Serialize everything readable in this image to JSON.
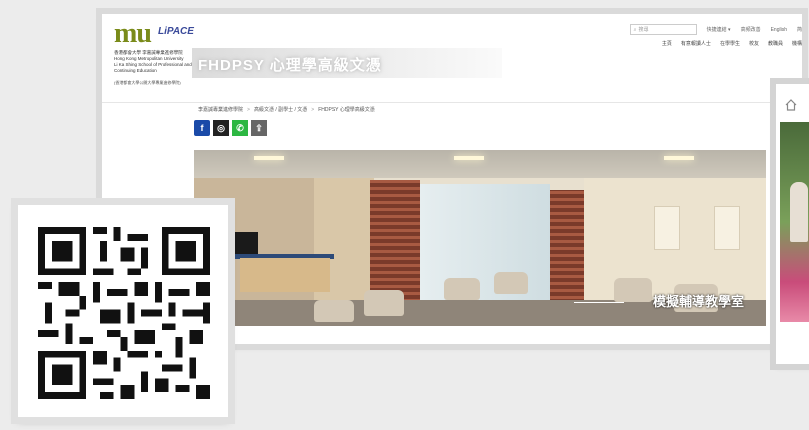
{
  "logo": {
    "mark": "mu",
    "brand": "LiPACE",
    "lines": [
      "香港都會大學 李嘉誠專業進修學院",
      "Hong Kong Metropolitan University",
      "Li Ka Shing School of Professional and",
      "Continuing Education"
    ],
    "slogan": "(香港都會大學公開大學專業進修學院)"
  },
  "banner_title": "FHDPSY 心理學高級文憑",
  "topbar": {
    "search_placeholder": "搜尋",
    "quick_links": "快捷連結",
    "sep": "▾",
    "lang_1": "高頻改善",
    "lang_2": "English",
    "lang_3": "简"
  },
  "nav": [
    "主頁",
    "有意報讀人士",
    "在學學生",
    "校友",
    "教職員",
    "機構"
  ],
  "breadcrumb": [
    "李嘉誠專業進修學院",
    "高級文憑 / 副學士 / 文憑",
    "FHDPSY 心理學高級文憑"
  ],
  "breadcrumb_sep": ">",
  "social": {
    "facebook": "f",
    "instagram": "◎",
    "whatsapp": "✆",
    "share": "⇪"
  },
  "photo_caption": "模擬輔導教學室",
  "colors": {
    "brand_green": "#7a8b1a",
    "brand_blue": "#3a4a9a",
    "facebook": "#1a4aa8",
    "whatsapp": "#2cb742"
  },
  "icons": [
    "search-icon",
    "facebook-icon",
    "instagram-icon",
    "whatsapp-icon",
    "share-icon",
    "home-icon",
    "qr-code"
  ]
}
